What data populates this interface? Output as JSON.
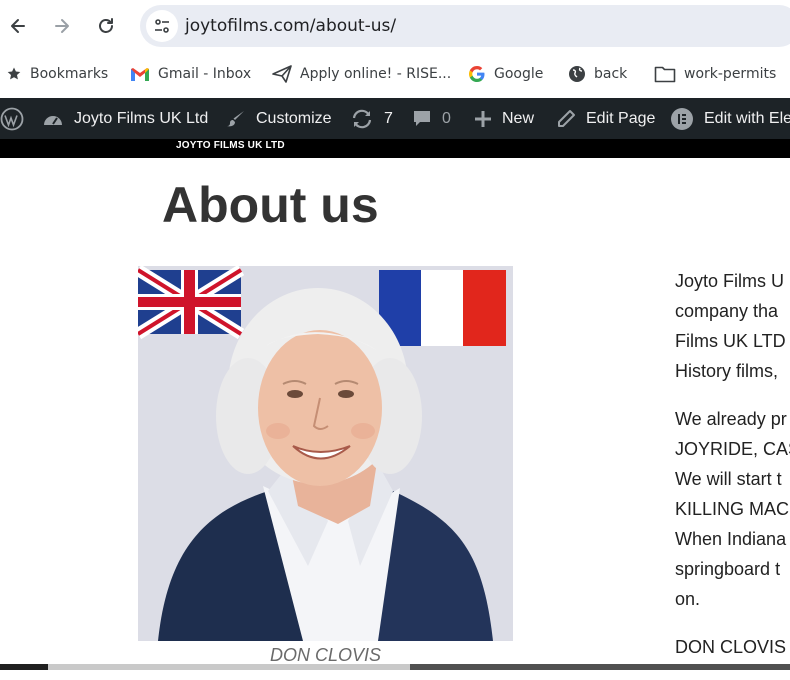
{
  "browser": {
    "url": "joytofilms.com/about-us/",
    "bookmarks": [
      {
        "label": "Bookmarks",
        "icon": "star-icon"
      },
      {
        "label": "Gmail - Inbox",
        "icon": "gmail-icon"
      },
      {
        "label": "Apply online! - RISE...",
        "icon": "send-icon"
      },
      {
        "label": "Google",
        "icon": "google-icon"
      },
      {
        "label": "back",
        "icon": "globe-icon"
      },
      {
        "label": "work-permits",
        "icon": "folder-icon"
      }
    ]
  },
  "admin_bar": {
    "site_name": "Joyto Films UK Ltd",
    "customize": "Customize",
    "updates_count": "7",
    "comments_count": "0",
    "new_label": "New",
    "edit_page": "Edit Page",
    "edit_with": "Edit with Ele"
  },
  "header": {
    "logo_text": "JOYTO FILMS UK LTD"
  },
  "main": {
    "title": "About us",
    "caption": "DON CLOVIS",
    "paragraphs": [
      [
        "Joyto Films U",
        "company tha",
        "Films UK LTD",
        "History films,"
      ],
      [
        "We already pr",
        "JOYRIDE, CAS",
        "We will start t",
        "KILLING MAC",
        "When Indiana",
        "springboard t",
        "on."
      ],
      [
        "DON CLOVIS"
      ]
    ]
  },
  "colors": {
    "admin_bar_bg": "#1d2327",
    "omnibox_bg": "#e9ecf3",
    "title_color": "#333333"
  }
}
